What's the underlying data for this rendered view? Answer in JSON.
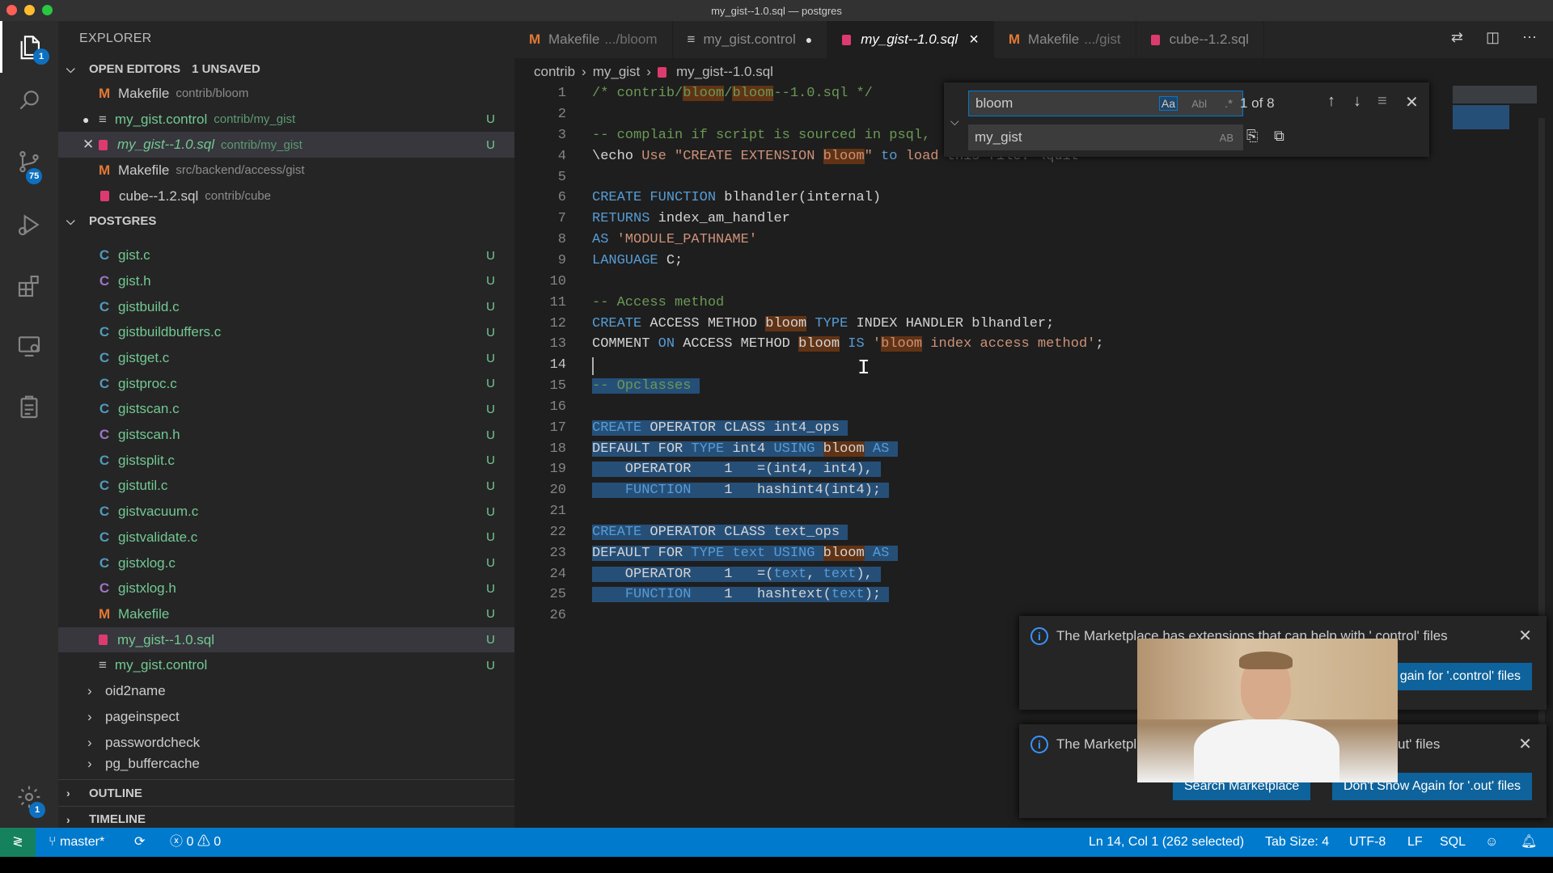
{
  "window": {
    "title": "my_gist--1.0.sql — postgres"
  },
  "activity_bar": {
    "explorer_badge": "1",
    "scm_badge": "75",
    "settings_badge": "1"
  },
  "sidebar": {
    "header": "EXPLORER",
    "open_editors": {
      "title": "OPEN EDITORS",
      "badge": "1 UNSAVED",
      "items": [
        {
          "name": "Makefile",
          "path": "contrib/bloom",
          "icon": "makefile-icon"
        },
        {
          "name": "my_gist.control",
          "path": "contrib/my_gist",
          "status": "U",
          "icon": "lines-icon"
        },
        {
          "name": "my_gist--1.0.sql",
          "path": "contrib/my_gist",
          "status": "U",
          "icon": "sql-icon"
        },
        {
          "name": "Makefile",
          "path": "src/backend/access/gist",
          "icon": "makefile-icon"
        },
        {
          "name": "cube--1.2.sql",
          "path": "contrib/cube",
          "icon": "sql-icon"
        }
      ]
    },
    "workspace": {
      "title": "POSTGRES",
      "files": [
        {
          "icon": "C",
          "name": "gist.c",
          "status": "U"
        },
        {
          "icon": "C",
          "name": "gist.h",
          "status": "U"
        },
        {
          "icon": "C",
          "name": "gistbuild.c",
          "status": "U"
        },
        {
          "icon": "C",
          "name": "gistbuildbuffers.c",
          "status": "U"
        },
        {
          "icon": "C",
          "name": "gistget.c",
          "status": "U"
        },
        {
          "icon": "C",
          "name": "gistproc.c",
          "status": "U"
        },
        {
          "icon": "C",
          "name": "gistscan.c",
          "status": "U"
        },
        {
          "icon": "C",
          "name": "gistscan.h",
          "status": "U"
        },
        {
          "icon": "C",
          "name": "gistsplit.c",
          "status": "U"
        },
        {
          "icon": "C",
          "name": "gistutil.c",
          "status": "U"
        },
        {
          "icon": "C",
          "name": "gistvacuum.c",
          "status": "U"
        },
        {
          "icon": "C",
          "name": "gistvalidate.c",
          "status": "U"
        },
        {
          "icon": "C",
          "name": "gistxlog.c",
          "status": "U"
        },
        {
          "icon": "C",
          "name": "gistxlog.h",
          "status": "U"
        },
        {
          "icon": "M",
          "name": "Makefile",
          "status": "U"
        },
        {
          "icon": "sql",
          "name": "my_gist--1.0.sql",
          "status": "U"
        },
        {
          "icon": "lines",
          "name": "my_gist.control",
          "status": "U"
        }
      ],
      "folders": [
        "oid2name",
        "pageinspect",
        "passwordcheck",
        "pg_buffercache"
      ]
    },
    "outline": "OUTLINE",
    "timeline": "TIMELINE"
  },
  "tabs": [
    {
      "name": "Makefile",
      "path": ".../bloom",
      "icon": "makefile-icon"
    },
    {
      "name": "my_gist.control",
      "path": "",
      "icon": "lines-icon",
      "dirty": "●"
    },
    {
      "name": "my_gist--1.0.sql",
      "path": "",
      "icon": "sql-icon",
      "close": "×"
    },
    {
      "name": "Makefile",
      "path": ".../gist",
      "icon": "makefile-icon"
    },
    {
      "name": "cube--1.2.sql",
      "path": "",
      "icon": "sql-icon"
    }
  ],
  "breadcrumb": [
    "contrib",
    "my_gist",
    "my_gist--1.0.sql"
  ],
  "find_widget": {
    "find_value": "bloom",
    "match_count": "1 of 8",
    "replace_value": "my_gist",
    "case_toggle": "Aa",
    "word_toggle": "Abl",
    "regex_toggle": ".*",
    "preserve_case": "AB"
  },
  "code_lines": [
    "1",
    "2",
    "3",
    "4",
    "5",
    "6",
    "7",
    "8",
    "9",
    "10",
    "11",
    "12",
    "13",
    "14",
    "15",
    "16",
    "17",
    "18",
    "19",
    "20",
    "21",
    "22",
    "23",
    "24",
    "25",
    "26"
  ],
  "notifications": [
    {
      "text": "The Marketplace has extensions that can help with '.control' files",
      "button": "gain for '.control' files"
    },
    {
      "text": "The Marketpl",
      "text_tail": "ut' files",
      "button_search": "Search Marketplace",
      "button_dont": "Don't Show Again for '.out' files"
    }
  ],
  "status_bar": {
    "branch": "master*",
    "errors": "0",
    "warnings": "0",
    "position": "Ln 14, Col 1 (262 selected)",
    "tab_size": "Tab Size: 4",
    "encoding": "UTF-8",
    "eol": "LF",
    "language": "SQL"
  },
  "colors": {
    "accent": "#007acc",
    "status_fg": "#ffffff",
    "untracked": "#73c991",
    "sql_icon": "#dd3b6f",
    "makefile_icon": "#e37933"
  }
}
